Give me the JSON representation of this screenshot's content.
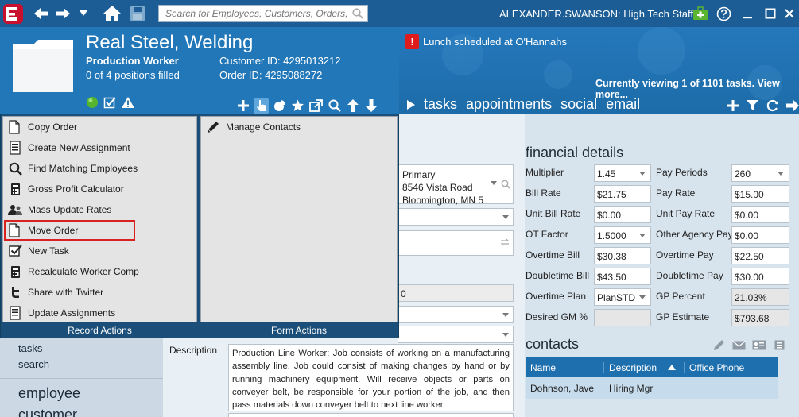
{
  "toolbar": {
    "logo_letter": "E",
    "search_placeholder": "Search for Employees, Customers, Orders, etc.",
    "user_label": "ALEXANDER.SWANSON: High Tech Staffing"
  },
  "header": {
    "title": "Real Steel, Welding",
    "position": "Production Worker",
    "positions_filled": "0 of 4 positions filled",
    "customer_id": "Customer ID: 4295013212",
    "order_id": "Order ID: 4295088272",
    "alert_badge": "!",
    "alert_text": "Lunch scheduled at O'Hannahs",
    "viewing_text": "Currently viewing 1 of 1101 tasks. View more..."
  },
  "nav_tabs": [
    "tasks",
    "appointments",
    "social",
    "email"
  ],
  "popup": {
    "record_actions": {
      "footer": "Record Actions",
      "items": [
        {
          "label": "Copy Order",
          "icon": "copy-icon"
        },
        {
          "label": "Create New Assignment",
          "icon": "document-list-icon"
        },
        {
          "label": "Find Matching Employees",
          "icon": "magnifier-icon"
        },
        {
          "label": "Gross Profit Calculator",
          "icon": "calculator-icon"
        },
        {
          "label": "Mass Update Rates",
          "icon": "people-icon"
        },
        {
          "label": "Move Order",
          "icon": "copy-icon"
        },
        {
          "label": "New Task",
          "icon": "checkbox-icon"
        },
        {
          "label": "Recalculate Worker Comp",
          "icon": "calculator-icon"
        },
        {
          "label": "Share with Twitter",
          "icon": "twitter-icon"
        },
        {
          "label": "Update Assignments",
          "icon": "document-list-icon"
        }
      ]
    },
    "form_actions": {
      "footer": "Form Actions",
      "items": [
        {
          "label": "Manage Contacts",
          "icon": "pencil-icon"
        }
      ]
    }
  },
  "left_nav": {
    "tasks": "tasks",
    "search": "search",
    "employee": "employee",
    "customer": "customer"
  },
  "form": {
    "address_line1": "Primary",
    "address_line2": "8546 Vista Road",
    "address_line3": "Bloomington, MN 5",
    "partial_value": "0",
    "description_label": "Description",
    "description_text": "Production Line Worker: Job consists of working on a manufacturing assembly line. Job could consist of making changes by hand or by running machinery equipment. Will receive objects or parts on conveyer belt, be responsible for your portion of the job, and then pass materials down conveyer belt to next line worker."
  },
  "financial": {
    "title": "financial details",
    "left": [
      {
        "label": "Multiplier",
        "value": "1.45",
        "select": true
      },
      {
        "label": "Bill Rate",
        "value": "$21.75"
      },
      {
        "label": "Unit Bill Rate",
        "value": "$0.00"
      },
      {
        "label": "OT Factor",
        "value": "1.5000",
        "select": true
      },
      {
        "label": "Overtime Bill",
        "value": "$30.38"
      },
      {
        "label": "Doubletime Bill",
        "value": "$43.50"
      },
      {
        "label": "Overtime Plan",
        "value": "PlanSTD",
        "select": true
      },
      {
        "label": "Desired GM %",
        "value": "",
        "gray": true
      }
    ],
    "right": [
      {
        "label": "Pay Periods",
        "value": "260",
        "select": true
      },
      {
        "label": "Pay Rate",
        "value": "$15.00"
      },
      {
        "label": "Unit Pay Rate",
        "value": "$0.00"
      },
      {
        "label": "Other Agency Pay",
        "value": "$0.00"
      },
      {
        "label": "Overtime Pay",
        "value": "$22.50"
      },
      {
        "label": "Doubletime Pay",
        "value": "$30.00"
      },
      {
        "label": "GP Percent",
        "value": "21.03%",
        "gray": true
      },
      {
        "label": "GP Estimate",
        "value": "$793.68",
        "gray": true
      }
    ]
  },
  "contacts": {
    "title": "contacts",
    "columns": [
      "Name",
      "Description",
      "Office Phone"
    ],
    "rows": [
      {
        "name": "Dohnson, Jave",
        "description": "Hiring Mgr",
        "phone": ""
      }
    ]
  },
  "colors": {
    "topbar": "#1b5d94",
    "header": "#2277b8",
    "accent_red": "#d82222",
    "table_head": "#1e6fae",
    "logo_red": "#c8102e"
  }
}
